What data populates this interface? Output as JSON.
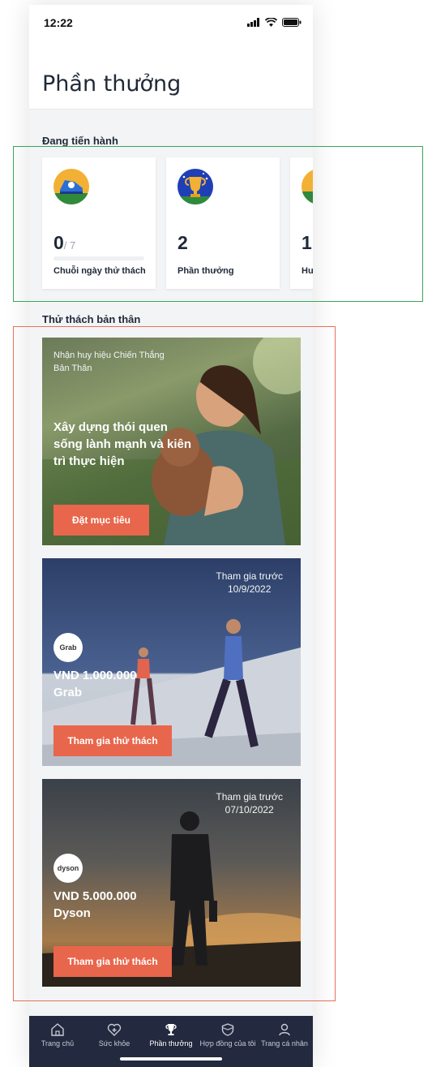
{
  "status_bar": {
    "time": "12:22"
  },
  "page_title": "Phần thưởng",
  "in_progress": {
    "title": "Đang tiến hành",
    "cards": [
      {
        "value": "0",
        "total": "/ 7",
        "label": "Chuỗi ngày thử thách",
        "progress": 0,
        "icon": "sneaker-icon"
      },
      {
        "value": "2",
        "label": "Phần thưởng",
        "icon": "trophy-icon"
      },
      {
        "value": "1",
        "label": "Huy hiệu",
        "icon": "runner-icon"
      }
    ]
  },
  "self_challenge": {
    "title": "Thử thách bản thân",
    "cards": [
      {
        "kicker": "Nhận huy hiệu Chiến Thắng Bản Thân",
        "headline": "Xây dựng thói quen sống lành mạnh và kiên trì thực hiện",
        "button": "Đặt mục tiêu"
      },
      {
        "deadline_label": "Tham gia trước",
        "deadline_date": "10/9/2022",
        "brand_logo": "Grab",
        "amount": "VND 1.000.000",
        "brand": "Grab",
        "button": "Tham gia thử thách"
      },
      {
        "deadline_label": "Tham gia trước",
        "deadline_date": "07/10/2022",
        "brand_logo": "dyson",
        "amount": "VND 5.000.000",
        "brand": "Dyson",
        "button": "Tham gia thử thách"
      }
    ]
  },
  "tabbar": {
    "items": [
      {
        "label": "Trang chủ",
        "icon": "home-icon"
      },
      {
        "label": "Sức khỏe",
        "icon": "heart-plus-icon"
      },
      {
        "label": "Phần thưởng",
        "icon": "trophy-icon",
        "active": true
      },
      {
        "label": "Hợp đồng của tôi",
        "icon": "shield-icon"
      },
      {
        "label": "Trang cá nhân",
        "icon": "person-icon"
      }
    ]
  },
  "colors": {
    "accent": "#e8664b",
    "tabbar": "#232a3f",
    "text": "#1f2937",
    "highlight_green": "#3aa55a",
    "highlight_red": "#e8705a"
  }
}
